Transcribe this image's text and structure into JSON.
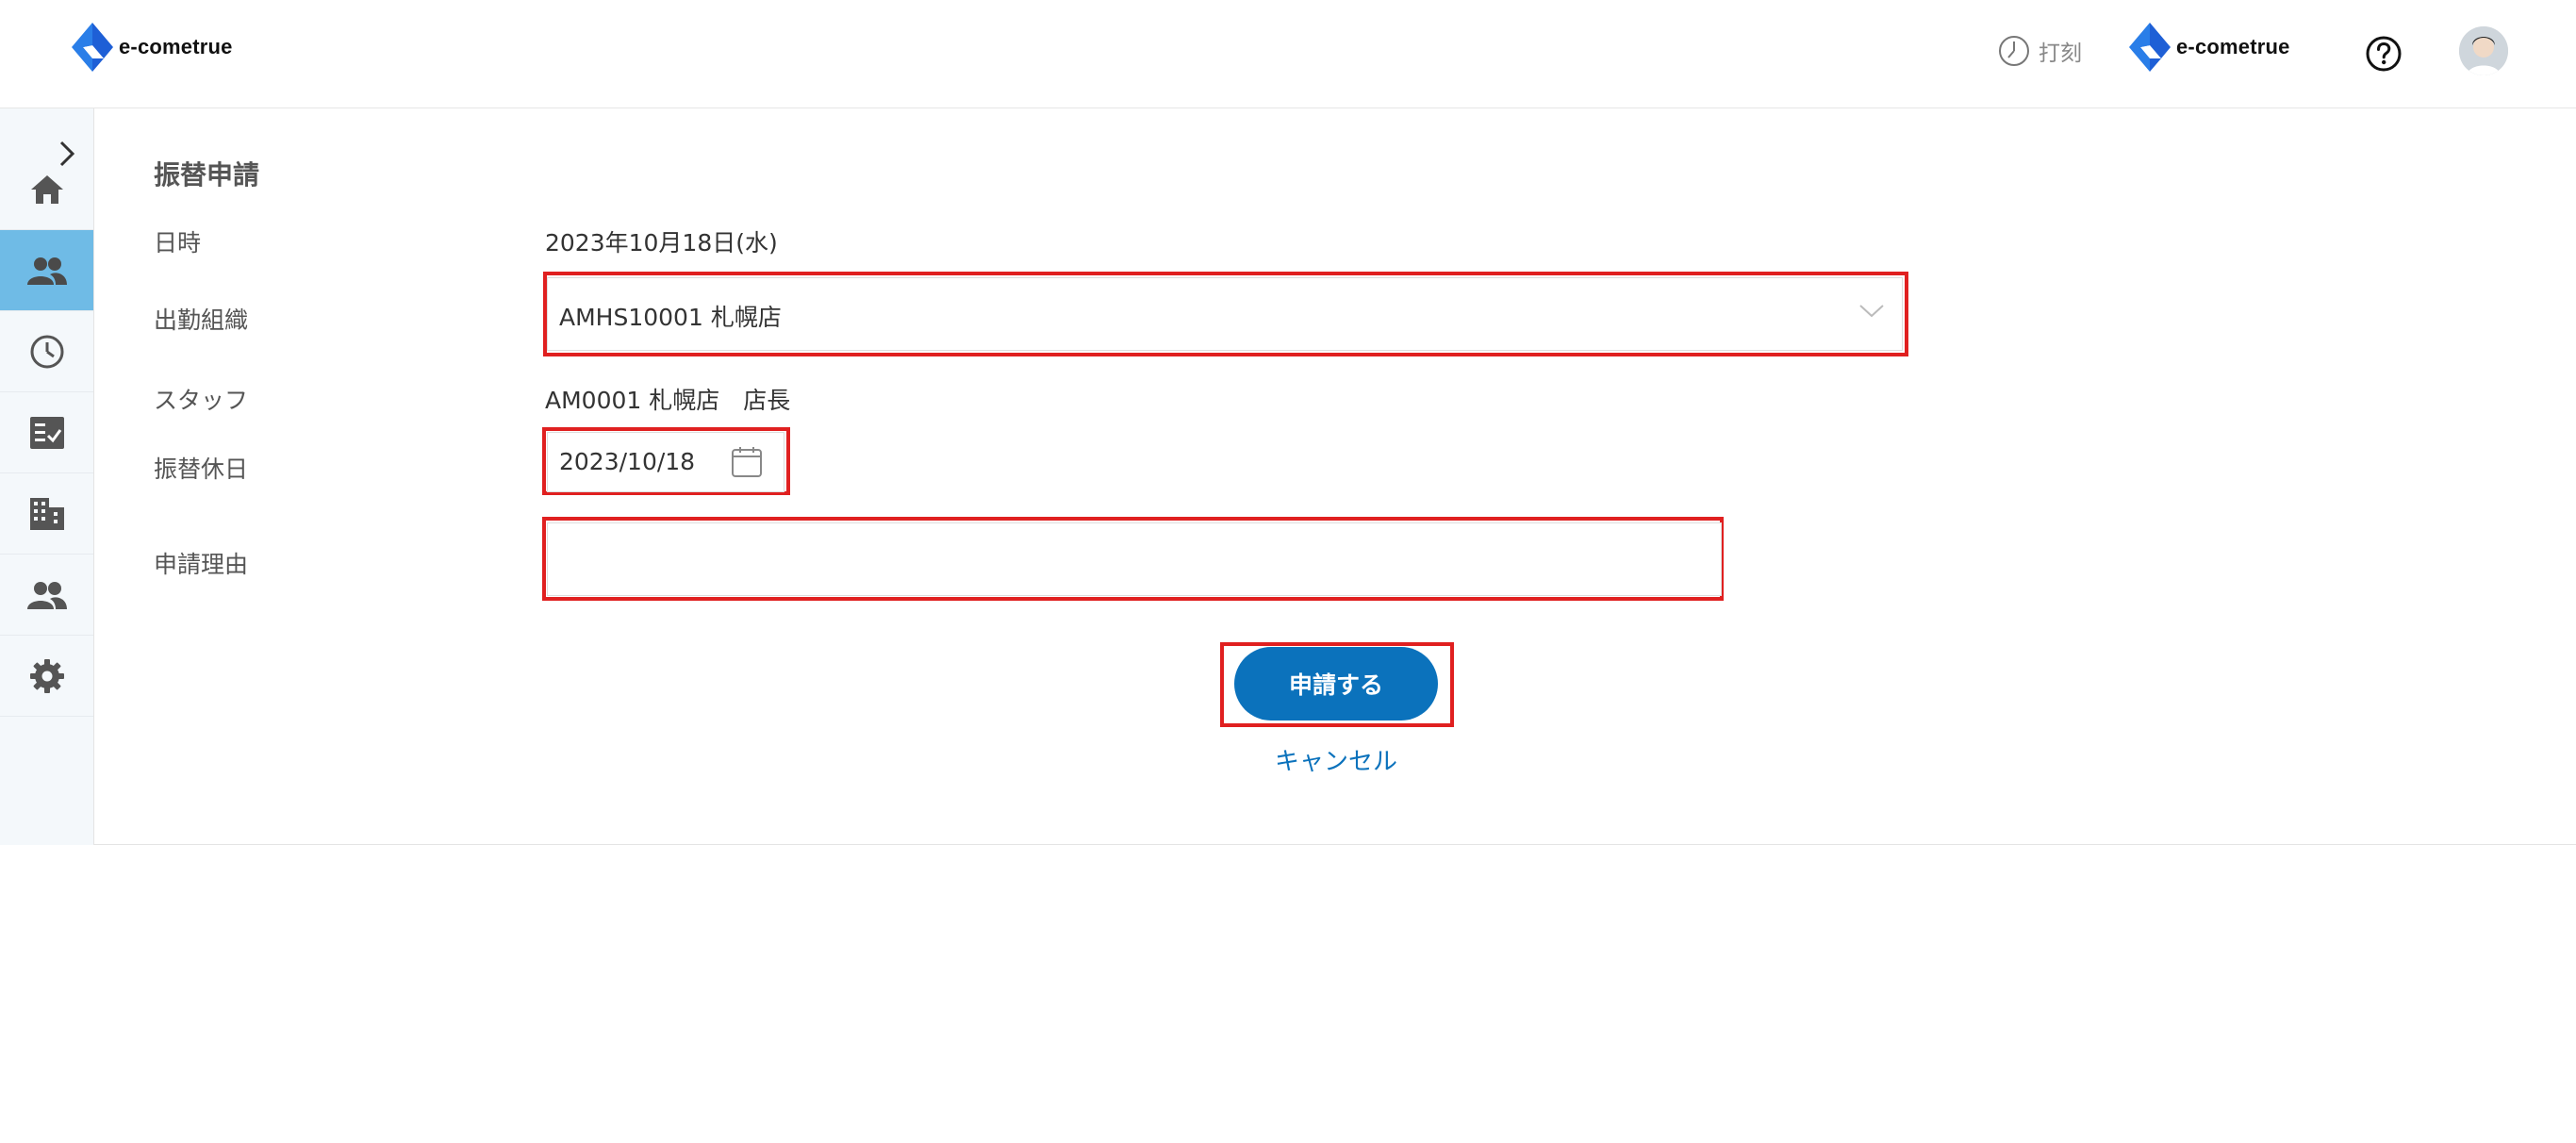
{
  "header": {
    "logo_text": "e-cometrue",
    "punch_label": "打刻",
    "right_logo_text": "e-cometrue"
  },
  "sidebar": {
    "items": [
      {
        "icon": "home-icon",
        "active": false
      },
      {
        "icon": "people-icon",
        "active": true
      },
      {
        "icon": "clock-icon",
        "active": false
      },
      {
        "icon": "checklist-icon",
        "active": false
      },
      {
        "icon": "building-icon",
        "active": false
      },
      {
        "icon": "people-icon",
        "active": false
      },
      {
        "icon": "gear-icon",
        "active": false
      }
    ]
  },
  "form": {
    "title": "振替申請",
    "datetime_label": "日時",
    "datetime_value": "2023年10月18日(水)",
    "org_label": "出勤組織",
    "org_value": "AMHS10001 札幌店",
    "staff_label": "スタッフ",
    "staff_value": "AM0001 札幌店　店長",
    "holiday_label": "振替休日",
    "holiday_value": "2023/10/18",
    "reason_label": "申請理由",
    "reason_value": "",
    "submit_label": "申請する",
    "cancel_label": "キャンセル"
  },
  "colors": {
    "accent": "#0b72bc",
    "highlight": "#e02020",
    "sidebar_active": "#6fbbe6"
  }
}
